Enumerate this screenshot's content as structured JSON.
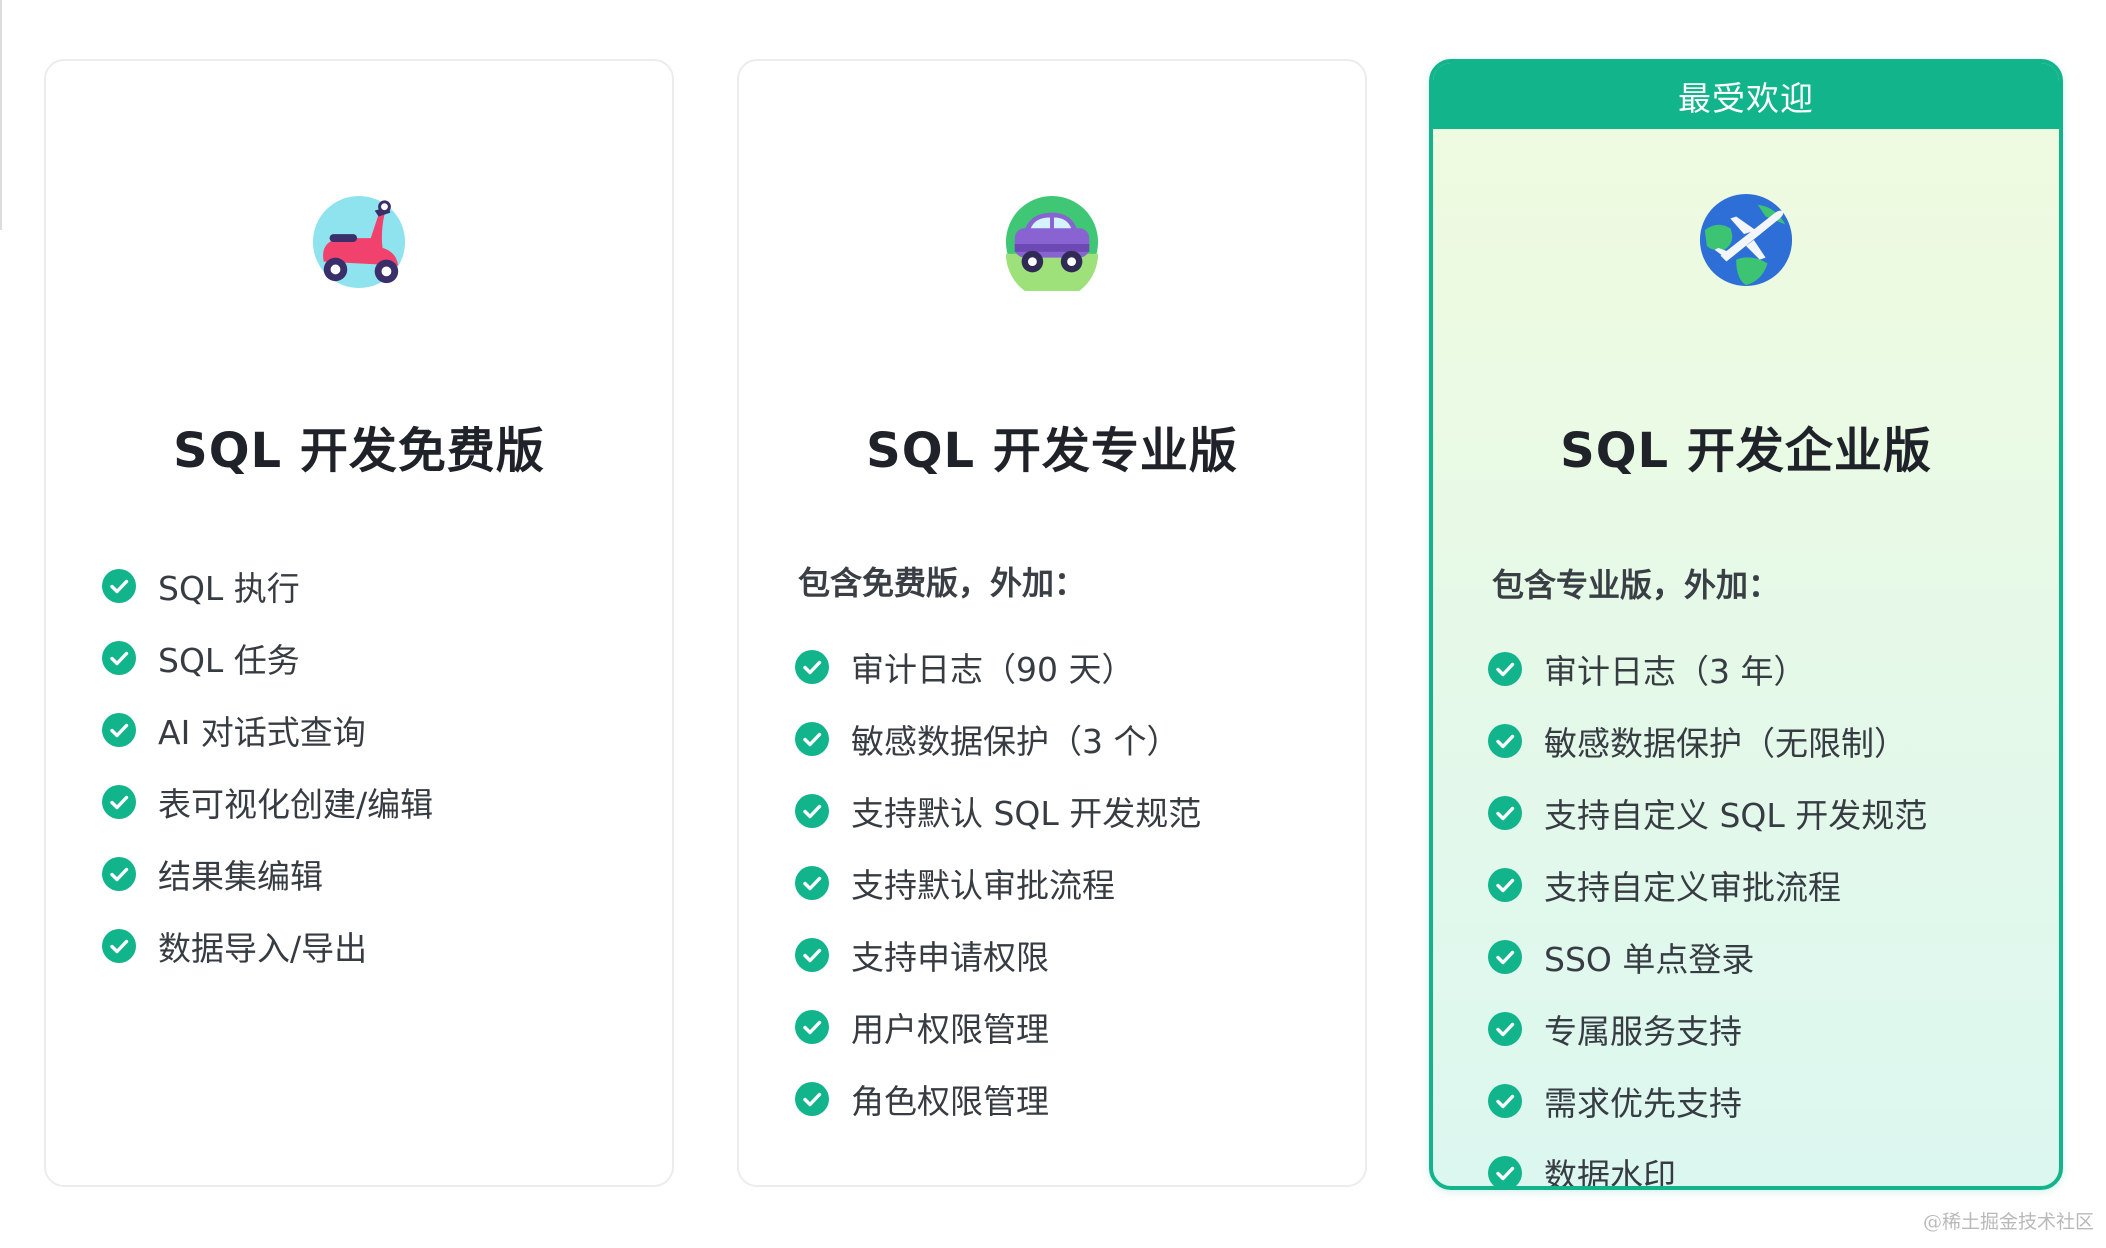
{
  "plans": [
    {
      "title": "SQL 开发免费版",
      "icon": "scooter-icon",
      "features": [
        "SQL 执行",
        "SQL 任务",
        "AI 对话式查询",
        "表可视化创建/编辑",
        "结果集编辑",
        "数据导入/导出"
      ]
    },
    {
      "title": "SQL 开发专业版",
      "icon": "car-icon",
      "includes": "包含免费版，外加：",
      "features": [
        "审计日志（90 天）",
        "敏感数据保护（3 个）",
        "支持默认 SQL 开发规范",
        "支持默认审批流程",
        "支持申请权限",
        "用户权限管理",
        "角色权限管理"
      ]
    },
    {
      "title": "SQL 开发企业版",
      "icon": "airplane-globe-icon",
      "badge": "最受欢迎",
      "includes": "包含专业版，外加：",
      "features": [
        "审计日志（3 年）",
        "敏感数据保护（无限制）",
        "支持自定义 SQL 开发规范",
        "支持自定义审批流程",
        "SSO 单点登录",
        "专属服务支持",
        "需求优先支持",
        "数据水印"
      ]
    }
  ],
  "watermark": "@稀土掘金技术社区",
  "colors": {
    "accent": "#12b48b",
    "text": "#1f2329"
  }
}
